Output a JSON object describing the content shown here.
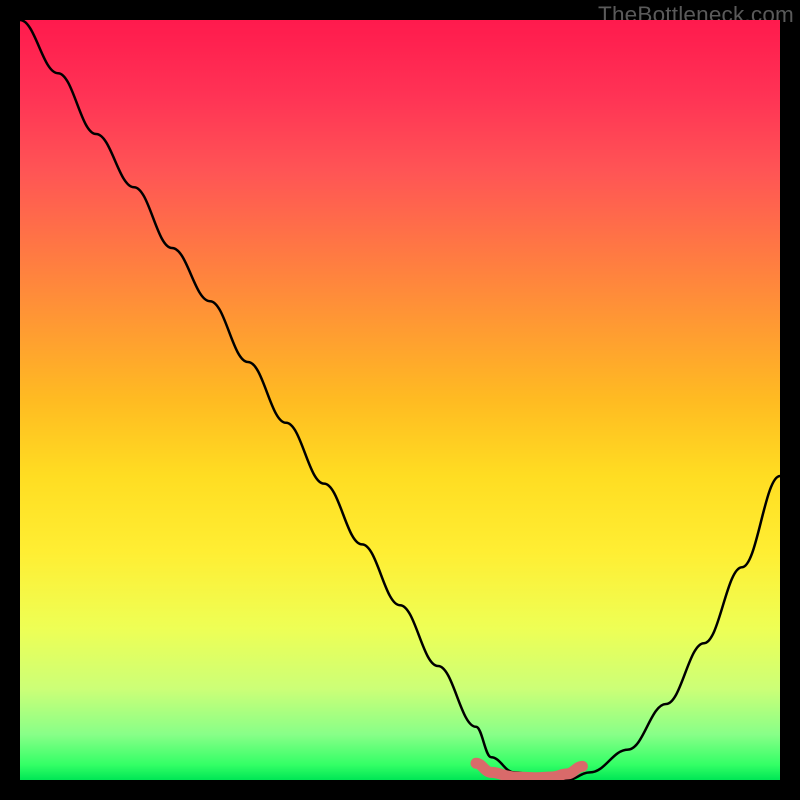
{
  "watermark": "TheBottleneck.com",
  "chart_data": {
    "type": "line",
    "title": "",
    "xlabel": "",
    "ylabel": "",
    "xlim": [
      0,
      100
    ],
    "ylim": [
      0,
      100
    ],
    "grid": false,
    "legend": false,
    "series": [
      {
        "name": "bottleneck-curve",
        "x": [
          0,
          5,
          10,
          15,
          20,
          25,
          30,
          35,
          40,
          45,
          50,
          55,
          60,
          62,
          65,
          70,
          72,
          75,
          80,
          85,
          90,
          95,
          100
        ],
        "values": [
          100,
          93,
          85,
          78,
          70,
          63,
          55,
          47,
          39,
          31,
          23,
          15,
          7,
          3,
          1,
          0,
          0,
          1,
          4,
          10,
          18,
          28,
          40
        ],
        "color": "#000000"
      },
      {
        "name": "optimal-band",
        "x": [
          60,
          62,
          65,
          68,
          70,
          72,
          74
        ],
        "values": [
          2.2,
          1.0,
          0.4,
          0.3,
          0.4,
          0.8,
          1.8
        ],
        "color": "#d96a6a"
      }
    ],
    "gradient_stops": [
      {
        "pos": 0,
        "color": "#ff1a4d"
      },
      {
        "pos": 50,
        "color": "#ffdd22"
      },
      {
        "pos": 100,
        "color": "#00e655"
      }
    ]
  }
}
